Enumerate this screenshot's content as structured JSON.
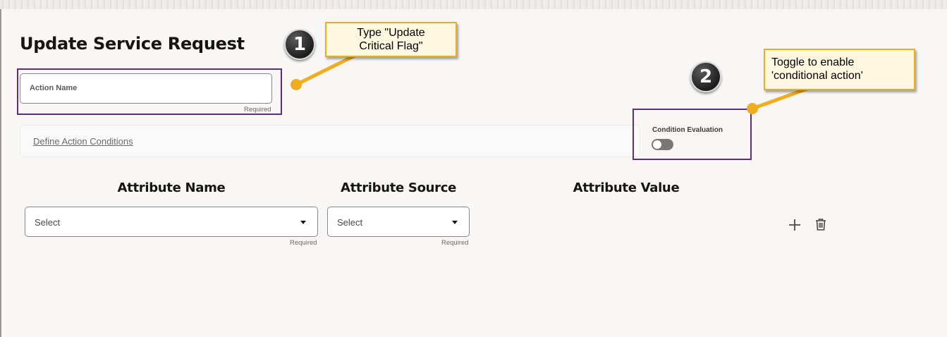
{
  "page": {
    "title": "Update Service Request"
  },
  "action_name": {
    "label": "Action Name",
    "required": "Required"
  },
  "conditions": {
    "link": "Define Action Conditions"
  },
  "condition_evaluation": {
    "label": "Condition Evaluation",
    "enabled": false
  },
  "attributes": {
    "headers": [
      "Attribute Name",
      "Attribute Source",
      "Attribute Value"
    ],
    "name_select": {
      "value": "Select",
      "required": "Required"
    },
    "source_select": {
      "value": "Select",
      "required": "Required"
    }
  },
  "icons": {
    "add": "plus-icon",
    "delete": "trash-icon",
    "dropdown": "chevron-down-icon"
  },
  "annotations": [
    {
      "number": "1",
      "text_line1": "Type \"Update",
      "text_line2": "Critical Flag\""
    },
    {
      "number": "2",
      "text_line1": "Toggle to enable",
      "text_line2": "'conditional action'"
    }
  ],
  "colors": {
    "highlight": "#5c2d82",
    "callout_border": "#f0ad1e",
    "callout_bg": "#fff8e1"
  }
}
